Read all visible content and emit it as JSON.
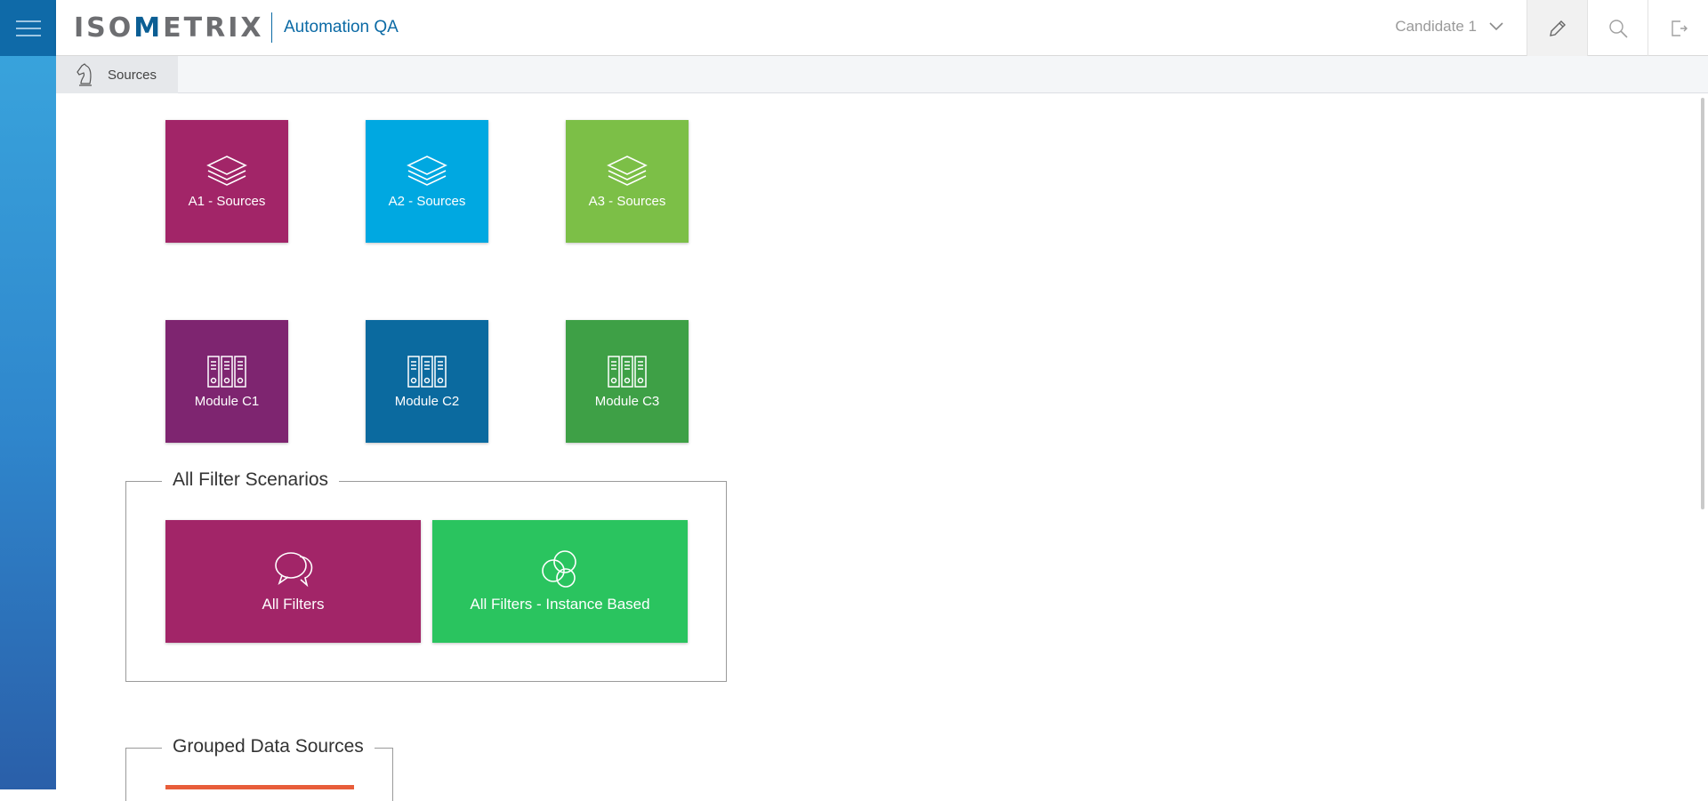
{
  "header": {
    "logo_prefix": "ISO",
    "logo_mark": "M",
    "logo_suffix": "ETRIX",
    "app_name": "Automation QA",
    "user_name": "Candidate 1"
  },
  "icons": {
    "menu": "hamburger-menu-icon",
    "edit": "pencil-icon",
    "search": "search-icon",
    "logout": "exit-icon",
    "chevron": "chevron-down-icon",
    "layers": "layers-icon",
    "binders": "binders-icon",
    "chat": "chat-bubbles-icon",
    "horse": "chess-knight-icon"
  },
  "breadcrumb": {
    "label": "Sources"
  },
  "tiles": [
    {
      "label": "A1 - Sources",
      "color": "#a22568"
    },
    {
      "label": "A2 - Sources",
      "color": "#00a8e1"
    },
    {
      "label": "A3 - Sources",
      "color": "#7cbf47"
    },
    {
      "label": "Module C1",
      "color": "#7e2570"
    },
    {
      "label": "Module C2",
      "color": "#0b6a9f"
    },
    {
      "label": "Module C3",
      "color": "#3ea046"
    }
  ],
  "groups": {
    "filter": {
      "title": "All Filter Scenarios",
      "tiles": [
        {
          "label": "All Filters",
          "color": "#a22568"
        },
        {
          "label": "All Filters - Instance Based",
          "color": "#2ac45f"
        }
      ]
    },
    "grouped": {
      "title": "Grouped Data Sources"
    }
  },
  "colors": {
    "accent": "#0b6aa5",
    "rail": "#2f86cc",
    "orange": "#e85d3a"
  }
}
